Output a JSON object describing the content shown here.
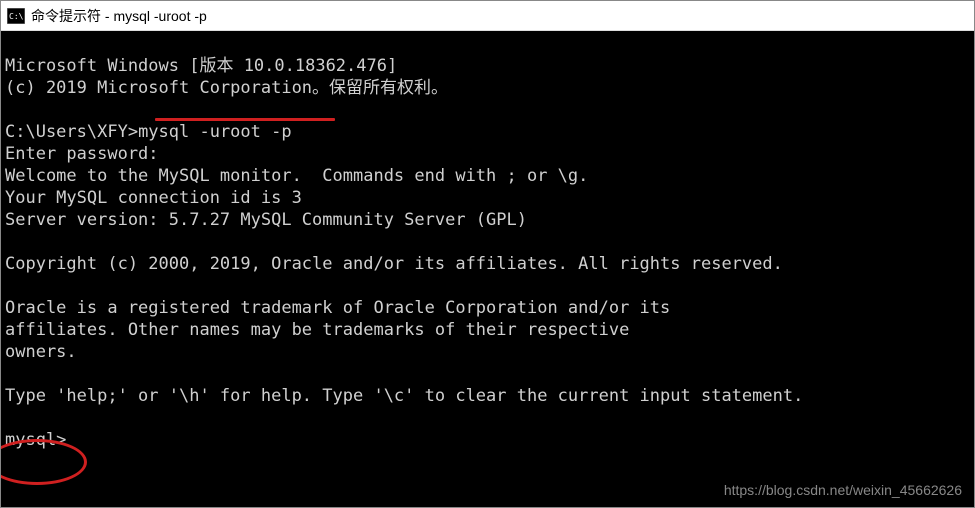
{
  "titlebar": {
    "title": "命令提示符 - mysql  -uroot -p"
  },
  "terminal": {
    "lines": {
      "l0": "Microsoft Windows [版本 10.0.18362.476]",
      "l1": "(c) 2019 Microsoft Corporation。保留所有权利。",
      "l2": "",
      "l3_prompt": "C:\\Users\\XFY>",
      "l3_cmd": "mysql -uroot -p",
      "l4": "Enter password:",
      "l5": "Welcome to the MySQL monitor.  Commands end with ; or \\g.",
      "l6": "Your MySQL connection id is 3",
      "l7": "Server version: 5.7.27 MySQL Community Server (GPL)",
      "l8": "",
      "l9": "Copyright (c) 2000, 2019, Oracle and/or its affiliates. All rights reserved.",
      "l10": "",
      "l11": "Oracle is a registered trademark of Oracle Corporation and/or its",
      "l12": "affiliates. Other names may be trademarks of their respective",
      "l13": "owners.",
      "l14": "",
      "l15": "Type 'help;' or '\\h' for help. Type '\\c' to clear the current input statement.",
      "l16": "",
      "l17": "mysql>"
    }
  },
  "watermark": "https://blog.csdn.net/weixin_45662626",
  "annotations": {
    "underline_color": "#d02020",
    "circle_color": "#d02020"
  }
}
